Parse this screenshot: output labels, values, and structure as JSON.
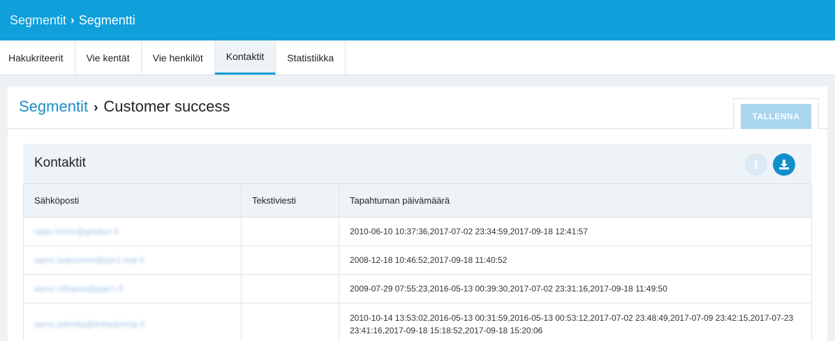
{
  "topbar": {
    "crumb_root": "Segmentit",
    "crumb_current": "Segmentti"
  },
  "tabs": [
    {
      "label": "Hakukriteerit",
      "active": false
    },
    {
      "label": "Vie kentät",
      "active": false
    },
    {
      "label": "Vie henkilöt",
      "active": false
    },
    {
      "label": "Kontaktit",
      "active": true
    },
    {
      "label": "Statistiikka",
      "active": false
    }
  ],
  "header": {
    "crumb_link": "Segmentit",
    "title": "Customer success",
    "save_label": "TALLENNA"
  },
  "panel": {
    "title": "Kontaktit",
    "icons": {
      "info": "info-icon",
      "download": "download-icon"
    },
    "columns": [
      "Sähköposti",
      "Tekstiviesti",
      "Tapahtuman päivämäärä"
    ],
    "rows": [
      {
        "email": "oppo.home@gladtan.fi",
        "sms": "",
        "dates": "2010-06-10 10:37:36,2017-07-02 23:34:59,2017-09-18 12:41:57"
      },
      {
        "email": "aamo.laaksonen@ppr1.mat.fi",
        "sms": "",
        "dates": "2008-12-18 10:46:52,2017-09-18 11:40:52"
      },
      {
        "email": "aamo.ollinpaa@pppr1.fi",
        "sms": "",
        "dates": "2009-07-29 07:55:23,2016-05-13 00:39:30,2017-07-02 23:31:16,2017-09-18 11:49:50"
      },
      {
        "email": "aamo.julkinlaj@llettadyshop.fi",
        "sms": "",
        "dates": "2010-10-14 13:53:02,2016-05-13 00:31:59,2016-05-13 00:53:12,2017-07-02 23:48:49,2017-07-09 23:42:15,2017-07-23 23:41:16,2017-09-18 15:18:52,2017-09-18 15:20:06"
      }
    ]
  },
  "colors": {
    "brand": "#0f9fdb",
    "link": "#1a8cc2",
    "save_disabled": "#a9d5ee"
  }
}
